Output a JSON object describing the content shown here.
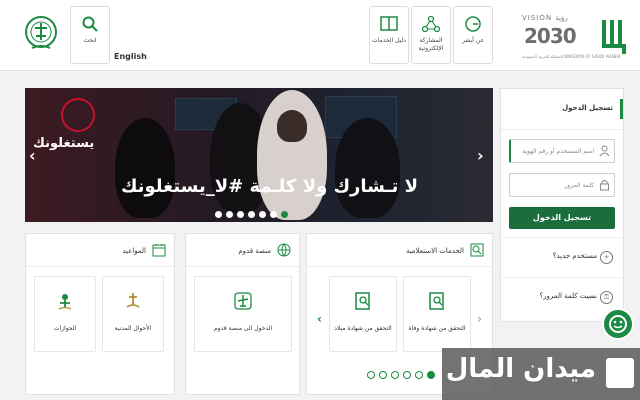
{
  "header": {
    "language_link": "English",
    "search_label": "ابحث",
    "nav": [
      {
        "label": "دليل الخدمات",
        "icon": "book-icon"
      },
      {
        "label": "المشاركة الإلكترونية",
        "icon": "network-icon"
      },
      {
        "label": "عن أبشر",
        "icon": "absher-g-icon"
      }
    ],
    "vision_word": "VISION رؤية",
    "vision_year": "2030",
    "vision_country": "المملكة العربية السعودية KINGDOM OF SAUDI ARABIA"
  },
  "banner": {
    "brand": "يستغلونك",
    "slogan": "لا تـشارك ولا كلـمة #لا_يستغلونك",
    "slide_count": 7,
    "active_slide": 7
  },
  "login": {
    "title": "تسجيل الدخول",
    "username_placeholder": "اسم المستخدم أو رقم الهوية",
    "password_placeholder": "كلمة المرور",
    "submit_label": "تسجيل الدخول",
    "new_user": "مستخدم جديد؟",
    "forgot_password": "نسيت كلمة المرور؟"
  },
  "cards": {
    "appointments": {
      "title": "المواعيد",
      "tiles": [
        {
          "label": "الأحوال المدنية",
          "icon": "civil-affairs-icon"
        },
        {
          "label": "الجوازات",
          "icon": "passports-icon"
        }
      ]
    },
    "arrival": {
      "title": "منصة قدوم",
      "tiles": [
        {
          "label": "الدخول الى منصة قدوم",
          "icon": "airplane-icon"
        }
      ]
    },
    "inquiry": {
      "title": "الخدمات الاستعلامية",
      "tiles": [
        {
          "label": "التحقق من شهادة وفاة",
          "icon": "document-search-icon"
        },
        {
          "label": "التحقق من شهادة ميلاد",
          "icon": "document-search-icon"
        }
      ],
      "page_dots": 6
    }
  },
  "watermark": "ميدان المال",
  "colors": {
    "brand_green": "#1c8a43",
    "dark_green": "#1b6e3c"
  }
}
